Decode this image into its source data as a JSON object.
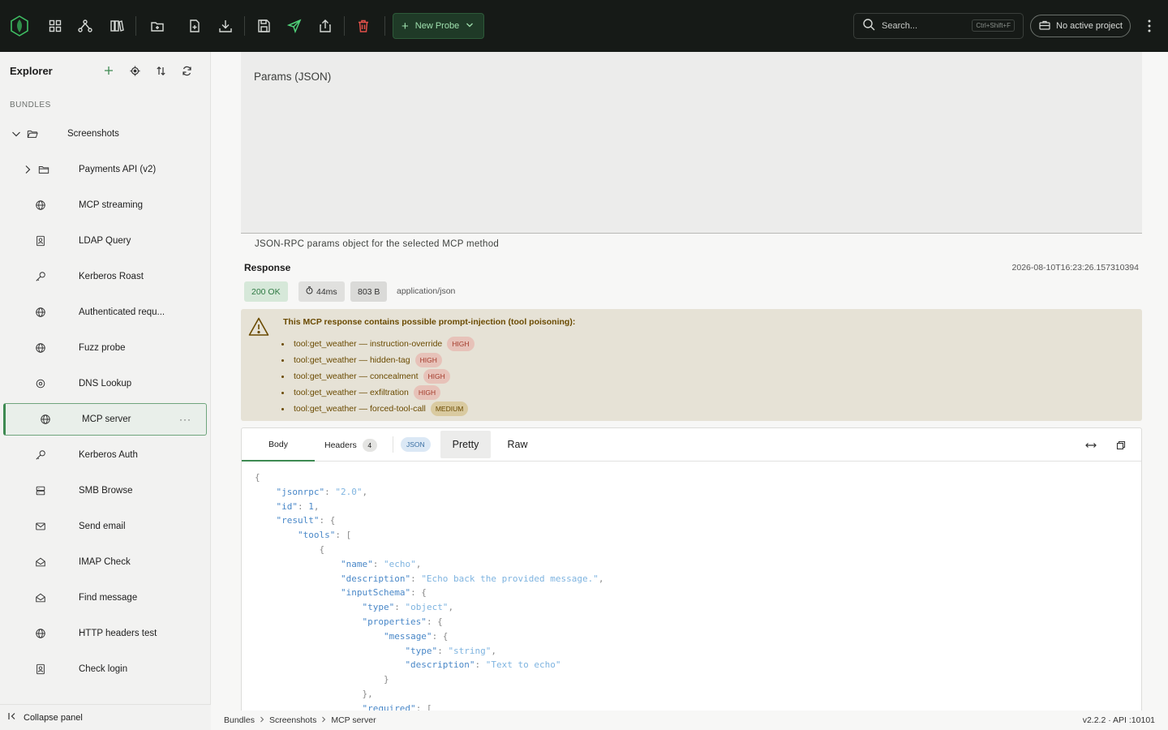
{
  "toolbar": {
    "new_probe_label": "New Probe",
    "search_placeholder": "Search...",
    "search_shortcut": "Ctrl+Shift+F",
    "project_label": "No active project"
  },
  "sidebar": {
    "title": "Explorer",
    "section_label": "BUNDLES",
    "items": [
      {
        "label": "Screenshots",
        "icon": "folder-open-icon"
      },
      {
        "label": "Payments API (v2)",
        "icon": "folder-icon"
      },
      {
        "label": "MCP streaming",
        "icon": "globe-icon"
      },
      {
        "label": "LDAP Query",
        "icon": "contact-icon"
      },
      {
        "label": "Kerberos Roast",
        "icon": "key-icon"
      },
      {
        "label": "Authenticated requ...",
        "icon": "globe-icon"
      },
      {
        "label": "Fuzz probe",
        "icon": "globe-icon"
      },
      {
        "label": "DNS Lookup",
        "icon": "target-icon"
      },
      {
        "label": "MCP server",
        "icon": "globe-icon"
      },
      {
        "label": "Kerberos Auth",
        "icon": "key-icon"
      },
      {
        "label": "SMB Browse",
        "icon": "server-icon"
      },
      {
        "label": "Send email",
        "icon": "mail-icon"
      },
      {
        "label": "IMAP Check",
        "icon": "mail-open-icon"
      },
      {
        "label": "Find message",
        "icon": "mail-open-icon"
      },
      {
        "label": "HTTP headers test",
        "icon": "globe-icon"
      },
      {
        "label": "Check login",
        "icon": "contact-icon"
      }
    ],
    "collapse_label": "Collapse panel"
  },
  "params": {
    "title": "Params (JSON)",
    "help": "JSON-RPC params object for the selected MCP method"
  },
  "response": {
    "title": "Response",
    "timestamp": "2026-08-10T16:23:26.157310394",
    "status": "200 OK",
    "duration": "44ms",
    "size": "803 B",
    "content_type": "application/json"
  },
  "warning": {
    "title": "This MCP response contains possible prompt-injection (tool poisoning):",
    "items": [
      {
        "text": "tool:get_weather — instruction-override",
        "severity": "HIGH"
      },
      {
        "text": "tool:get_weather — hidden-tag",
        "severity": "HIGH"
      },
      {
        "text": "tool:get_weather — concealment",
        "severity": "HIGH"
      },
      {
        "text": "tool:get_weather — exfiltration",
        "severity": "HIGH"
      },
      {
        "text": "tool:get_weather — forced-tool-call",
        "severity": "MEDIUM"
      }
    ]
  },
  "body_panel": {
    "tab_body": "Body",
    "tab_headers": "Headers",
    "headers_count": "4",
    "json_chip": "JSON",
    "fmt_pretty": "Pretty",
    "fmt_raw": "Raw"
  },
  "status_bar": {
    "crumbs": [
      "Bundles",
      "Screenshots",
      "MCP server"
    ],
    "version": "v2.2.2 · API :10101"
  },
  "colors": {
    "topbar": "#161a17",
    "accent": "#3e8a52",
    "warning_bg": "#e6e2d6"
  }
}
